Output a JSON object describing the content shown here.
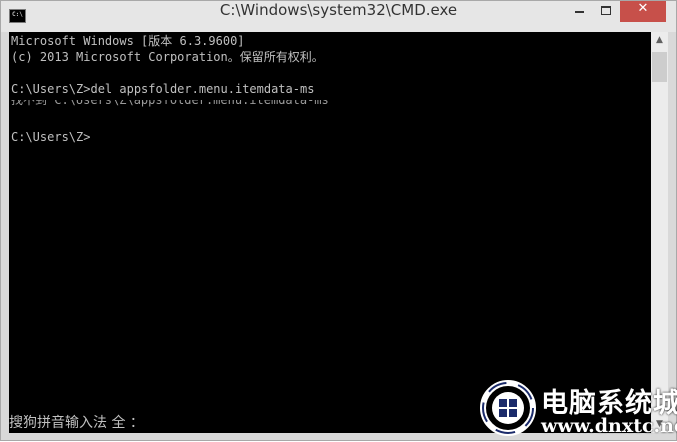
{
  "window": {
    "title": "C:\\Windows\\system32\\CMD.exe",
    "icon_name": "cmd-icon",
    "icon_label": "C:\\",
    "close_label": "✕"
  },
  "console": {
    "lines": [
      "Microsoft Windows [版本 6.3.9600]",
      "(c) 2013 Microsoft Corporation。保留所有权利。",
      "",
      "C:\\Users\\Z>del appsfolder.menu.itemdata-ms",
      "找不到 C:\\Users\\Z\\appsfolder.menu.itemdata-ms",
      "",
      "C:\\Users\\Z>"
    ]
  },
  "scrollbar": {
    "up_arrow": "▲",
    "down_arrow": "▼"
  },
  "ime": {
    "text": "搜狗拼音输入法 全 ："
  },
  "watermark": {
    "name": "电脑系统城",
    "url": "www.dnxtc.net"
  },
  "colors": {
    "console_bg": "#000000",
    "console_text": "#c0c0c0",
    "close_button": "#c7504a",
    "titlebar": "#e6e6e6"
  }
}
